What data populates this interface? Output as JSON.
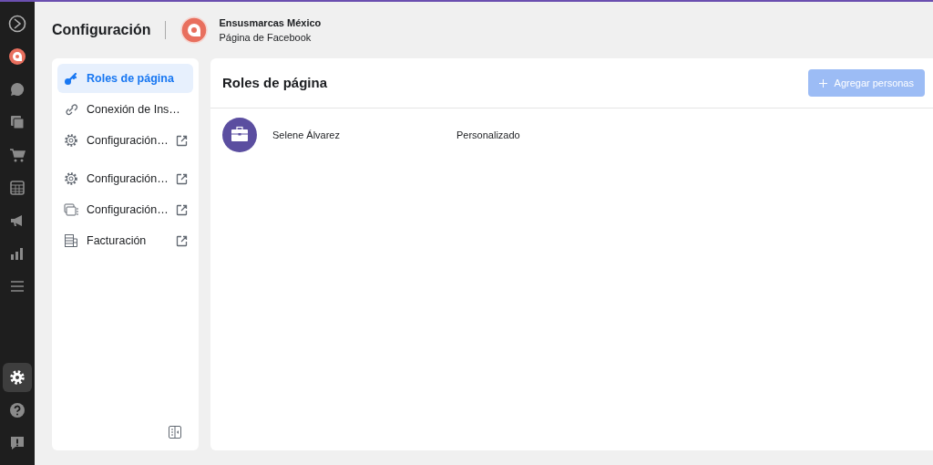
{
  "header": {
    "title": "Configuración",
    "page_name": "Ensusmarcas México",
    "page_type": "Página de Facebook"
  },
  "rail": {
    "top": [
      {
        "kind": "logo",
        "selected": false
      },
      {
        "kind": "avatar",
        "selected": false
      },
      {
        "kind": "chat",
        "selected": false
      },
      {
        "kind": "pages",
        "selected": false
      },
      {
        "kind": "cart",
        "selected": false
      },
      {
        "kind": "calendar",
        "selected": false
      },
      {
        "kind": "megaphone",
        "selected": false
      },
      {
        "kind": "chart",
        "selected": false
      },
      {
        "kind": "menu",
        "selected": false
      }
    ],
    "bottom": [
      {
        "kind": "gear",
        "selected": true
      },
      {
        "kind": "help",
        "selected": false
      },
      {
        "kind": "report",
        "selected": false
      }
    ]
  },
  "sidebar": {
    "groups": [
      [
        {
          "label": "Roles de página",
          "kind": "key",
          "external": false,
          "selected": true
        },
        {
          "label": "Conexión de Ins…",
          "kind": "link",
          "external": false,
          "selected": false
        },
        {
          "label": "Configuración…",
          "kind": "gear",
          "external": true,
          "selected": false
        }
      ],
      [
        {
          "label": "Configuración…",
          "kind": "gear",
          "external": true,
          "selected": false
        },
        {
          "label": "Configuración…",
          "kind": "screens",
          "external": true,
          "selected": false
        },
        {
          "label": "Facturación",
          "kind": "billing",
          "external": true,
          "selected": false
        }
      ]
    ]
  },
  "main": {
    "title": "Roles de página",
    "add_button": {
      "label": "Agregar personas",
      "disabled": true
    },
    "rows": [
      {
        "name": "Selene Álvarez",
        "role": "Personalizado"
      }
    ]
  }
}
